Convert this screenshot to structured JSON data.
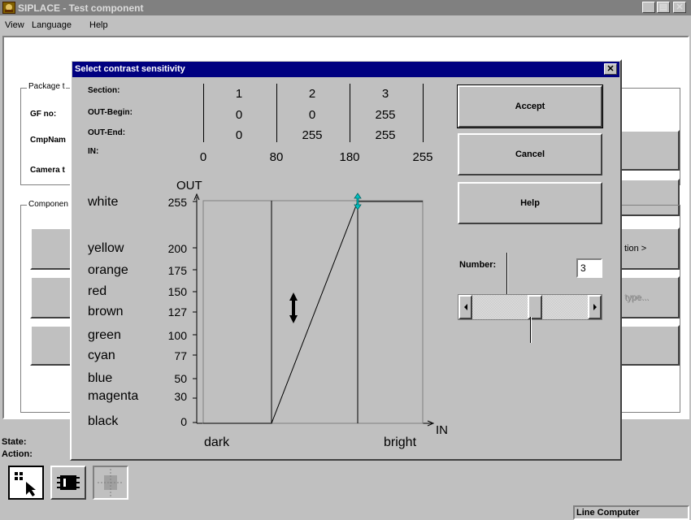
{
  "window": {
    "title": "SIPLACE - Test component"
  },
  "menu": {
    "view": "View",
    "language": "Language",
    "help": "Help"
  },
  "background": {
    "package_group": "Package t",
    "gf_no": "GF no:",
    "cmp_name": "CmpNam",
    "camera": "Camera t",
    "component_group": "Componen",
    "btn_right_1": "tion >",
    "btn_right_2": "type...",
    "state": "State:",
    "action": "Action:",
    "statusbar": "Line Computer"
  },
  "dialog": {
    "title": "Select contrast sensitivity",
    "table": {
      "section_label": "Section:",
      "out_begin_label": "OUT-Begin:",
      "out_end_label": "OUT-End:",
      "in_label": "IN:",
      "sections": [
        "1",
        "2",
        "3"
      ],
      "out_begin": [
        "0",
        "0",
        "255"
      ],
      "out_end": [
        "0",
        "255",
        "255"
      ],
      "in_ticks": [
        "0",
        "80",
        "180",
        "255"
      ]
    },
    "graph": {
      "out_label": "OUT",
      "in_label": "IN",
      "dark": "dark",
      "bright": "bright",
      "levels": [
        {
          "name": "white",
          "value": "255"
        },
        {
          "name": "yellow",
          "value": "200"
        },
        {
          "name": "orange",
          "value": "175"
        },
        {
          "name": "red",
          "value": "150"
        },
        {
          "name": "brown",
          "value": "127"
        },
        {
          "name": "green",
          "value": "100"
        },
        {
          "name": "cyan",
          "value": "77"
        },
        {
          "name": "blue",
          "value": "50"
        },
        {
          "name": "magenta",
          "value": "30"
        },
        {
          "name": "black",
          "value": "0"
        }
      ]
    },
    "buttons": {
      "accept": "Accept",
      "cancel": "Cancel",
      "help": "Help"
    },
    "number_label": "Number:",
    "number_value": "3",
    "slider_fraction": 0.55
  }
}
